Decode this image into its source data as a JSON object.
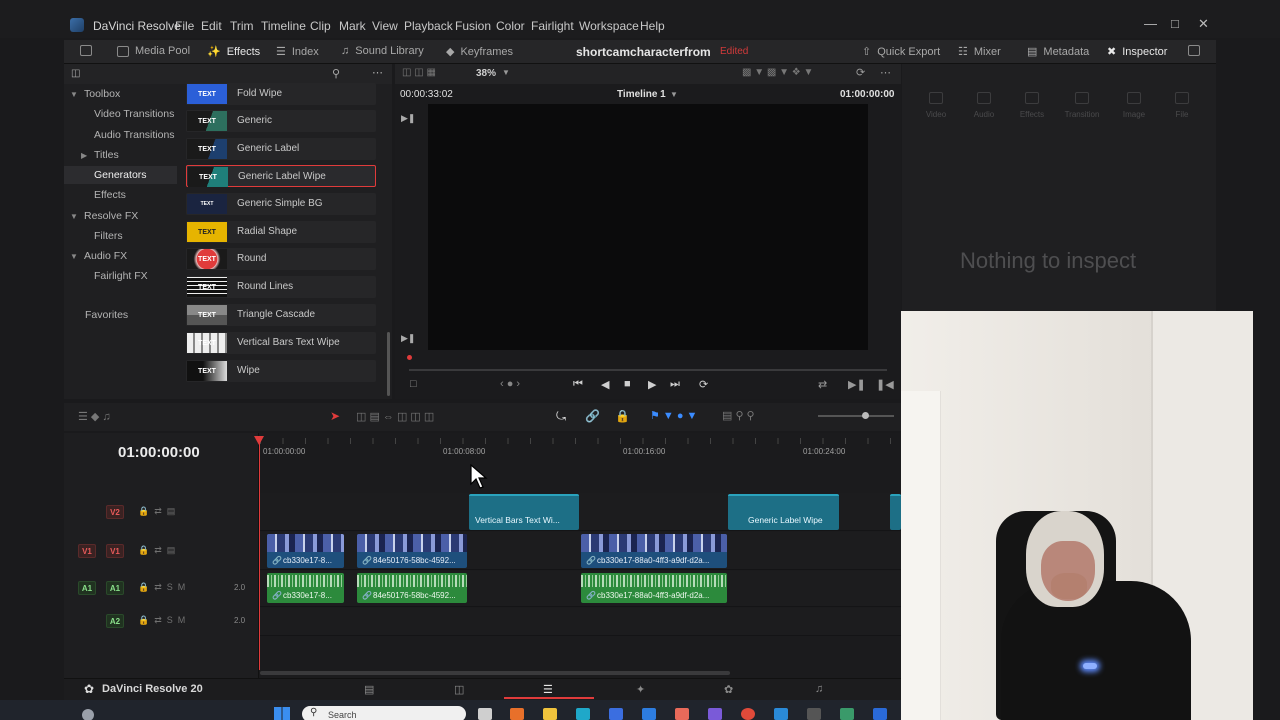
{
  "app": {
    "name": "DaVinci Resolve",
    "version_label": "DaVinci Resolve 20"
  },
  "menu": [
    "File",
    "Edit",
    "Trim",
    "Timeline",
    "Clip",
    "Mark",
    "View",
    "Playback",
    "Fusion",
    "Color",
    "Fairlight",
    "Workspace",
    "Help"
  ],
  "toolbar": {
    "media_pool": "Media Pool",
    "effects": "Effects",
    "index": "Index",
    "sound_library": "Sound Library",
    "keyframes": "Keyframes",
    "project_title": "shortcamcharacterfrom",
    "edited": "Edited",
    "quick_export": "Quick Export",
    "mixer": "Mixer",
    "metadata": "Metadata",
    "inspector": "Inspector"
  },
  "tree": {
    "toolbox": "Toolbox",
    "video_transitions": "Video Transitions",
    "audio_transitions": "Audio Transitions",
    "titles": "Titles",
    "generators": "Generators",
    "effects": "Effects",
    "resolve_fx": "Resolve FX",
    "filters": "Filters",
    "audio_fx": "Audio FX",
    "fairlight_fx": "Fairlight FX",
    "favorites": "Favorites"
  },
  "effects_list": [
    {
      "label": "Fold Wipe",
      "thumb": "TEXT"
    },
    {
      "label": "Generic",
      "thumb": "TEXT"
    },
    {
      "label": "Generic Label",
      "thumb": "TEXT"
    },
    {
      "label": "Generic Label Wipe",
      "thumb": "TEXT"
    },
    {
      "label": "Generic Simple BG",
      "thumb": "TEXT"
    },
    {
      "label": "Radial Shape",
      "thumb": "TEXT"
    },
    {
      "label": "Round",
      "thumb": "TEXT"
    },
    {
      "label": "Round Lines",
      "thumb": "TEXT"
    },
    {
      "label": "Triangle Cascade",
      "thumb": "TEXT"
    },
    {
      "label": "Vertical Bars Text Wipe",
      "thumb": "TEXT"
    },
    {
      "label": "Wipe",
      "thumb": "TEXT"
    }
  ],
  "viewer": {
    "zoom": "38%",
    "source_timecode": "00:00:33:02",
    "timeline_name": "Timeline 1",
    "record_timecode": "01:00:00:00"
  },
  "inspector": {
    "tabs": [
      "Video",
      "Audio",
      "Effects",
      "Transition",
      "Image",
      "File"
    ],
    "empty_message": "Nothing to inspect"
  },
  "timeline": {
    "timecode": "01:00:00:00",
    "ruler": [
      "01:00:00:00",
      "01:00:08:00",
      "01:00:16:00",
      "01:00:24:00"
    ],
    "tracks": {
      "v2": {
        "src": "V2",
        "volume": ""
      },
      "v1": {
        "src": "V1",
        "dst": "V1"
      },
      "a1": {
        "src": "A1",
        "dst": "A1",
        "volume": "2.0"
      },
      "a2": {
        "dst": "A2",
        "volume": "2.0"
      }
    },
    "clips": {
      "v2_a": "Vertical Bars Text Wi...",
      "v2_b": "Generic Label Wipe",
      "v1_a": "cb330e17-8...",
      "v1_b": "84e50176-58bc-4592...",
      "v1_c": "cb330e17-88a0-4ff3-a9df-d2a...",
      "a1_a": "cb330e17-8...",
      "a1_b": "84e50176-58bc-4592...",
      "a1_c": "cb330e17-88a0-4ff3-a9df-d2a..."
    }
  },
  "taskbar": {
    "search_placeholder": "Search"
  },
  "colors": {
    "accent_red": "#e03b3b",
    "title_clip": "#1d6f86",
    "video_clip": "#1e4f7c",
    "audio_clip": "#2c8a3c"
  }
}
